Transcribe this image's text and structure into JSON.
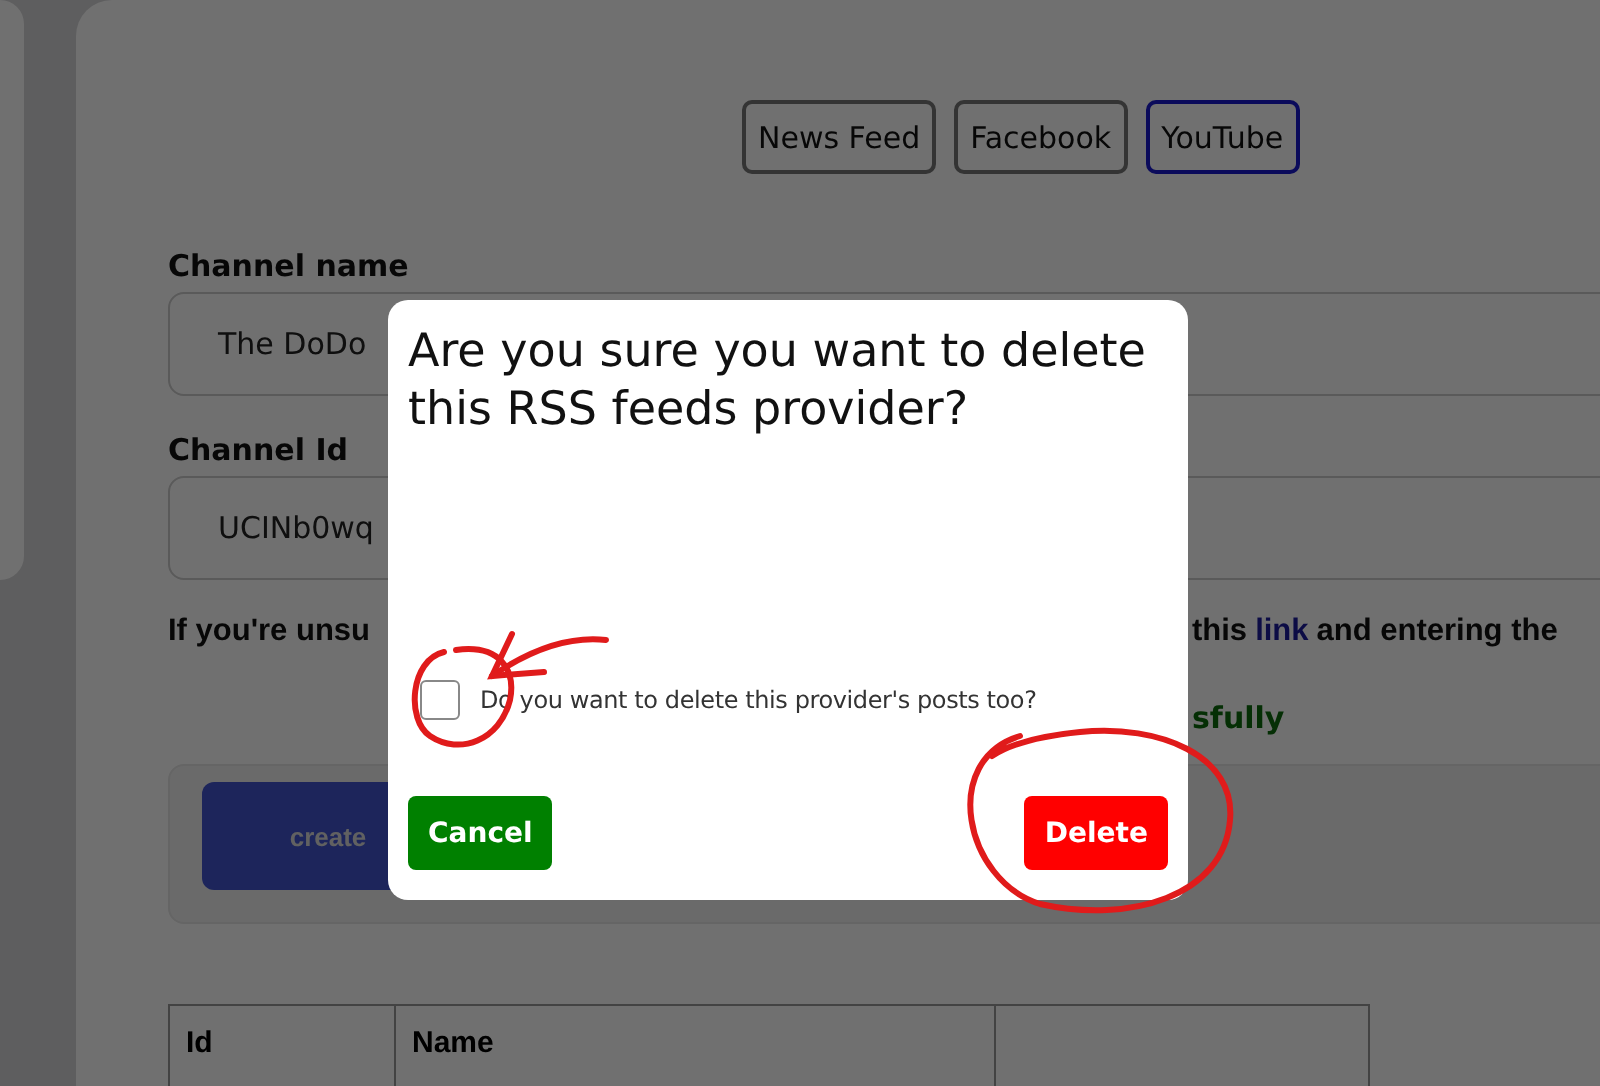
{
  "tabs": [
    {
      "label": "News Feed",
      "selected": false
    },
    {
      "label": "Facebook",
      "selected": false
    },
    {
      "label": "YouTube",
      "selected": true
    }
  ],
  "form": {
    "fields": [
      {
        "label": "Channel name",
        "value": "The DoDo"
      },
      {
        "label": "Channel Id",
        "value": "UCINb0wq"
      }
    ],
    "info_text_start": "If you're unsu",
    "info_text_middle": "this",
    "info_link": "link",
    "info_text_end": "and entering the",
    "status_text": "sfully",
    "create_button": "create"
  },
  "table": {
    "columns": [
      "Id",
      "Name"
    ]
  },
  "modal": {
    "title": "Are you sure you want to delete this RSS feeds provider?",
    "checkbox": {
      "label": "Do you want to delete this provider's posts too?",
      "checked": false
    },
    "buttons": [
      {
        "label": "Cancel",
        "kind": "cancel"
      },
      {
        "label": "Delete",
        "kind": "delete"
      }
    ]
  }
}
